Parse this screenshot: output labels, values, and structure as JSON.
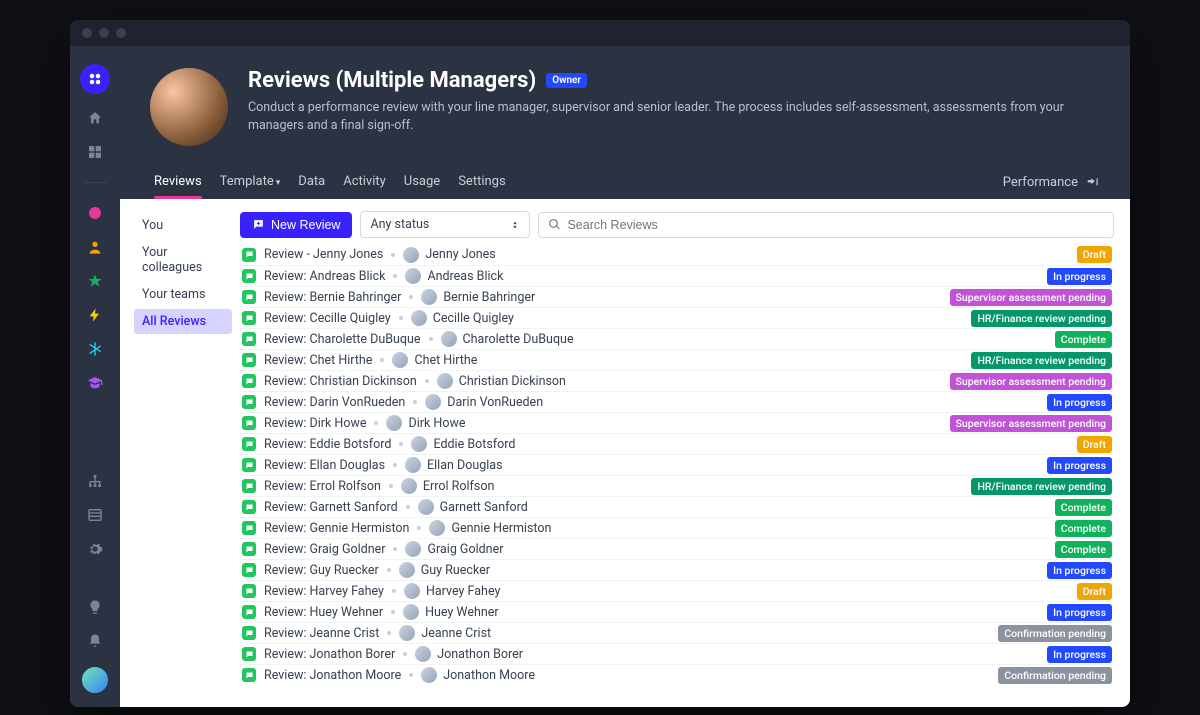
{
  "header": {
    "title": "Reviews (Multiple Managers)",
    "owner_badge": "Owner",
    "subtitle": "Conduct a performance review with your line manager, supervisor and senior leader. The process includes self-assessment, assessments from your managers and a final sign-off."
  },
  "tabs": {
    "items": [
      "Reviews",
      "Template",
      "Data",
      "Activity",
      "Usage",
      "Settings"
    ],
    "active_index": 0
  },
  "breadcrumb": {
    "label": "Performance"
  },
  "filters": {
    "items": [
      "You",
      "Your colleagues",
      "Your teams",
      "All Reviews"
    ],
    "active_index": 3
  },
  "toolbar": {
    "new_label": "New Review",
    "status_filter": "Any status",
    "search_placeholder": "Search Reviews"
  },
  "status_labels": {
    "draft": "Draft",
    "inprogress": "In progress",
    "super": "Supervisor assessment pending",
    "hr": "HR/Finance review pending",
    "complete": "Complete",
    "confirm": "Confirmation pending"
  },
  "rows": [
    {
      "title": "Review - Jenny Jones",
      "assignee": "Jenny Jones",
      "status": "draft"
    },
    {
      "title": "Review: Andreas Blick",
      "assignee": "Andreas Blick",
      "status": "inprogress"
    },
    {
      "title": "Review: Bernie Bahringer",
      "assignee": "Bernie Bahringer",
      "status": "super"
    },
    {
      "title": "Review: Cecille Quigley",
      "assignee": "Cecille Quigley",
      "status": "hr"
    },
    {
      "title": "Review: Charolette DuBuque",
      "assignee": "Charolette DuBuque",
      "status": "complete"
    },
    {
      "title": "Review: Chet Hirthe",
      "assignee": "Chet Hirthe",
      "status": "hr"
    },
    {
      "title": "Review: Christian Dickinson",
      "assignee": "Christian Dickinson",
      "status": "super"
    },
    {
      "title": "Review: Darin VonRueden",
      "assignee": "Darin VonRueden",
      "status": "inprogress"
    },
    {
      "title": "Review: Dirk Howe",
      "assignee": "Dirk Howe",
      "status": "super"
    },
    {
      "title": "Review: Eddie Botsford",
      "assignee": "Eddie Botsford",
      "status": "draft"
    },
    {
      "title": "Review: Ellan Douglas",
      "assignee": "Ellan Douglas",
      "status": "inprogress"
    },
    {
      "title": "Review: Errol Rolfson",
      "assignee": "Errol Rolfson",
      "status": "hr"
    },
    {
      "title": "Review: Garnett Sanford",
      "assignee": "Garnett Sanford",
      "status": "complete"
    },
    {
      "title": "Review: Gennie Hermiston",
      "assignee": "Gennie Hermiston",
      "status": "complete"
    },
    {
      "title": "Review: Graig Goldner",
      "assignee": "Graig Goldner",
      "status": "complete"
    },
    {
      "title": "Review: Guy Ruecker",
      "assignee": "Guy Ruecker",
      "status": "inprogress"
    },
    {
      "title": "Review: Harvey Fahey",
      "assignee": "Harvey Fahey",
      "status": "draft"
    },
    {
      "title": "Review: Huey Wehner",
      "assignee": "Huey Wehner",
      "status": "inprogress"
    },
    {
      "title": "Review: Jeanne Crist",
      "assignee": "Jeanne Crist",
      "status": "confirm"
    },
    {
      "title": "Review: Jonathon Borer",
      "assignee": "Jonathon Borer",
      "status": "inprogress"
    },
    {
      "title": "Review: Jonathon Moore",
      "assignee": "Jonathon Moore",
      "status": "confirm"
    }
  ]
}
